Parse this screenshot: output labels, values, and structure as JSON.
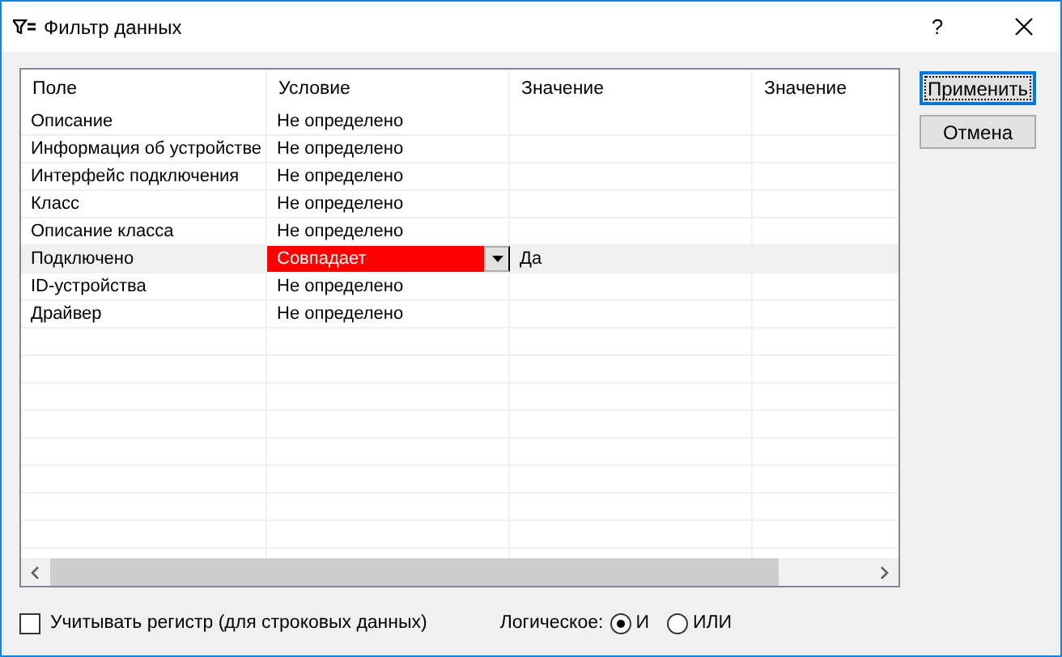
{
  "window": {
    "title": "Фильтр данных",
    "help": "?"
  },
  "table": {
    "columns": [
      "Поле",
      "Условие",
      "Значение",
      "Значение"
    ],
    "rows": [
      {
        "field": "Описание",
        "condition": "Не определено",
        "selected": false
      },
      {
        "field": "Информация об устройстве",
        "condition": "Не определено",
        "selected": false
      },
      {
        "field": "Интерфейс подключения",
        "condition": "Не определено",
        "selected": false
      },
      {
        "field": "Класс",
        "condition": "Не определено",
        "selected": false
      },
      {
        "field": "Описание класса",
        "condition": "Не определено",
        "selected": false
      },
      {
        "field": "Подключено",
        "condition": "Совпадает",
        "value": "Да",
        "selected": true
      },
      {
        "field": "ID-устройства",
        "condition": "Не определено",
        "selected": false
      },
      {
        "field": "Драйвер",
        "condition": "Не определено",
        "selected": false
      }
    ]
  },
  "buttons": [
    {
      "label": "Применить",
      "focused": true
    },
    {
      "label": "Отмена",
      "focused": false
    }
  ],
  "case_sensitive": {
    "label": "Учитывать регистр (для строковых данных)",
    "checked": false
  },
  "logic": {
    "label": "Логическое:",
    "options": [
      {
        "label": "И",
        "selected": true
      },
      {
        "label": "ИЛИ",
        "selected": false
      }
    ]
  }
}
